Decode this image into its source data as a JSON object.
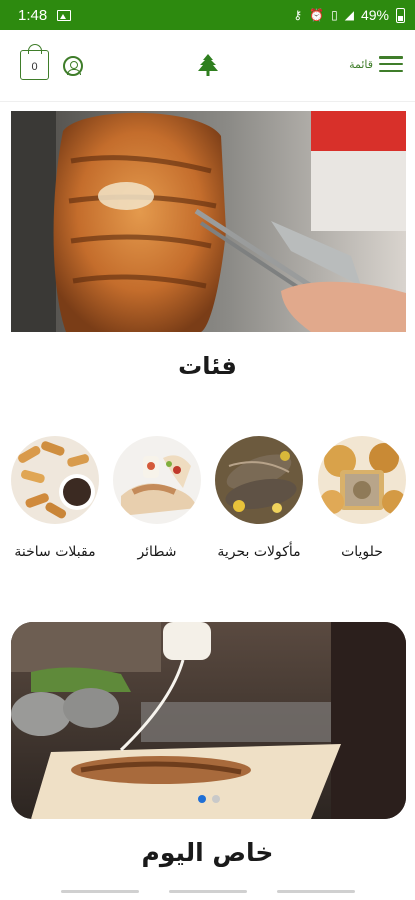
{
  "status_bar": {
    "time": "1:48",
    "battery": "49%",
    "icons": [
      "image-icon",
      "key-icon",
      "alarm-icon",
      "vibrate-icon",
      "signal-icon",
      "battery-icon"
    ]
  },
  "header": {
    "cart_count": "0",
    "menu_label": "قائمة",
    "accent_color": "#3f7d2a",
    "status_bar_color": "#2d8a0f"
  },
  "hero": {
    "image": "shawarma-carving-photo"
  },
  "categories": {
    "title": "فئات",
    "items": [
      {
        "label": "حلويات",
        "image": "sweets-photo"
      },
      {
        "label": "مأكولات بحرية",
        "image": "seafood-photo"
      },
      {
        "label": "شطائر",
        "image": "sandwiches-photo"
      },
      {
        "label": "مقبلات ساخنة",
        "image": "hot-appetizers-photo"
      }
    ]
  },
  "promo": {
    "image": "shawarma-wrap-photo",
    "slides": 2,
    "active_slide": 1
  },
  "specials": {
    "title": "خاص اليوم"
  }
}
